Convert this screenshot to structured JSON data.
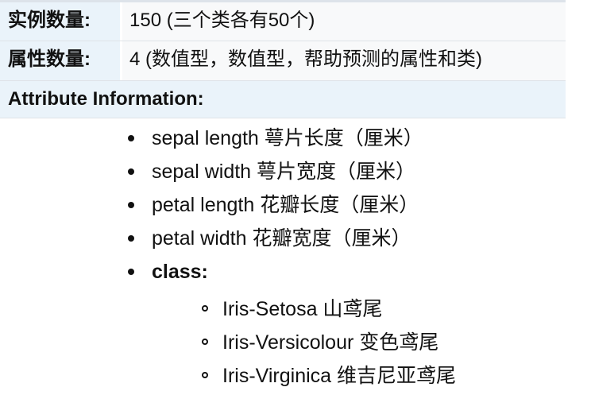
{
  "table": {
    "rows": [
      {
        "label": "实例数量:",
        "value": "150 (三个类各有50个)"
      },
      {
        "label": "属性数量:",
        "value": "4 (数值型，数值型，帮助预测的属性和类)"
      }
    ],
    "section_header": "Attribute Information:"
  },
  "attributes": [
    "sepal length 萼片长度（厘米）",
    "sepal width 萼片宽度（厘米）",
    "petal length 花瓣长度（厘米）",
    "petal width 花瓣宽度（厘米）",
    "class:"
  ],
  "classes": [
    "Iris-Setosa 山鸢尾",
    "Iris-Versicolour 变色鸢尾",
    "Iris-Virginica 维吉尼亚鸢尾"
  ],
  "colors": {
    "label_background": "#eaf3fa",
    "value_background": "#f8f9fa",
    "border": "#dfe3e8",
    "text": "#111111"
  }
}
